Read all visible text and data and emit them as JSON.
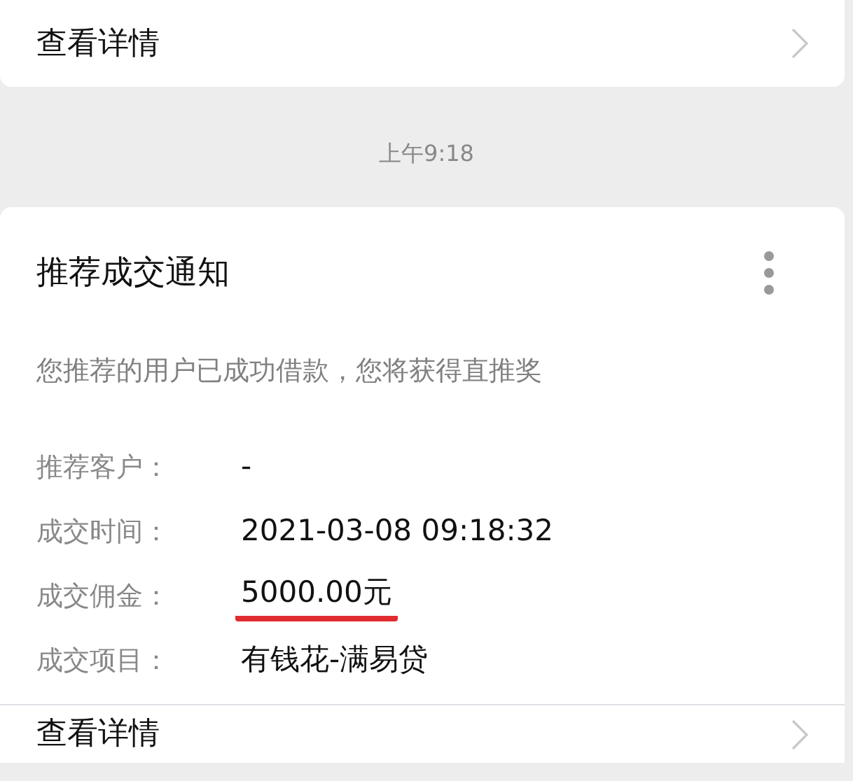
{
  "top_card": {
    "link": "查看详情"
  },
  "timestamp": "上午9:18",
  "message": {
    "title": "推荐成交通知",
    "description": "您推荐的用户已成功借款，您将获得直推奖",
    "fields": [
      {
        "label": "推荐客户：",
        "value": "-",
        "underlined": false
      },
      {
        "label": "成交时间：",
        "value": "2021-03-08 09:18:32",
        "underlined": false
      },
      {
        "label": "成交佣金：",
        "value": "5000.00元",
        "underlined": true
      },
      {
        "label": "成交项目：",
        "value": "有钱花-满易贷",
        "underlined": false
      }
    ],
    "link": "查看详情"
  }
}
